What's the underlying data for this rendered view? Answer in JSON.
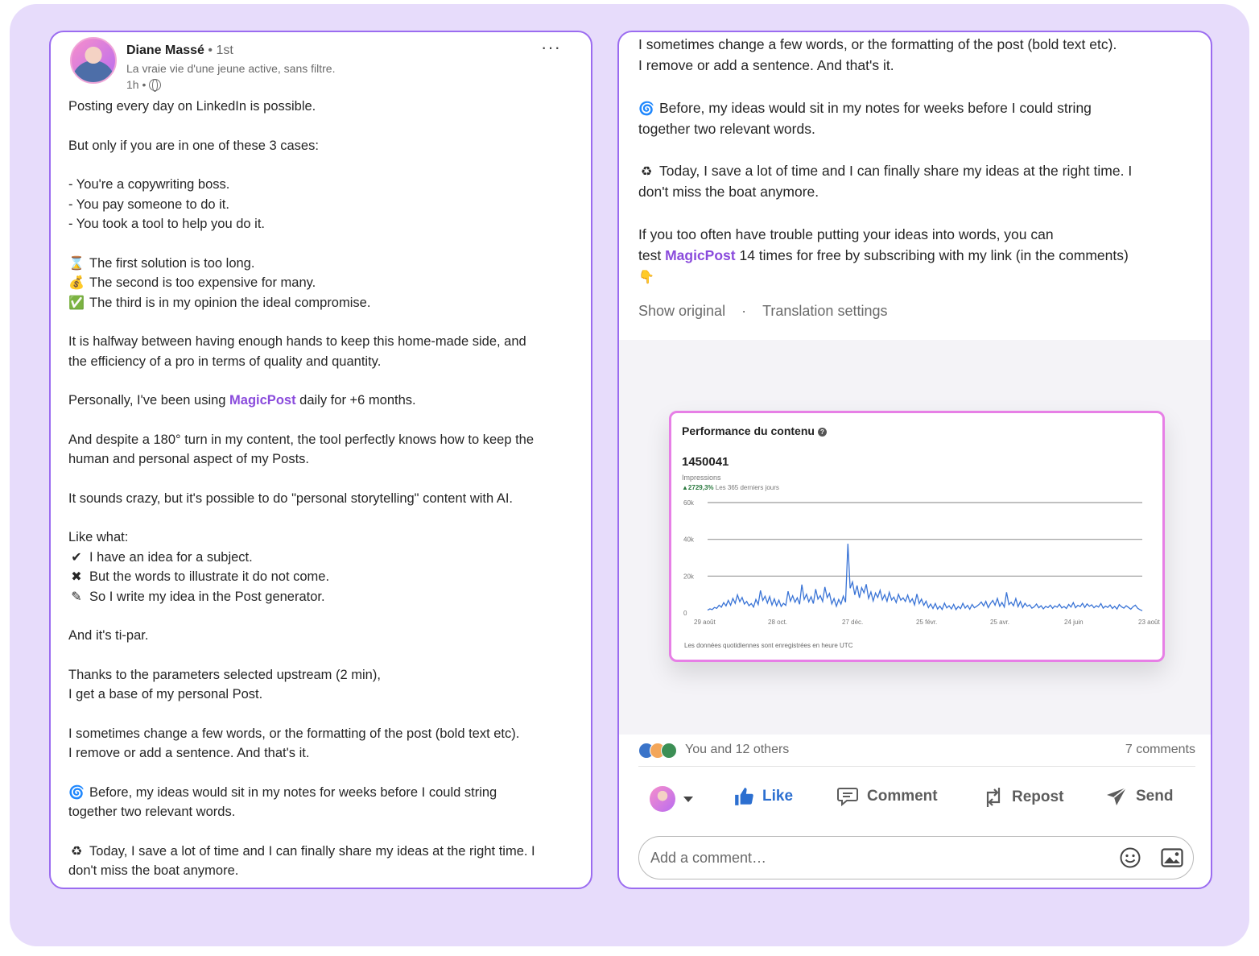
{
  "post": {
    "author_name": "Diane Massé",
    "author_degree": "• 1st",
    "author_tagline": "La vraie vie d'une jeune active, sans filtre.",
    "time": "1h •",
    "more": "···"
  },
  "left_lines": [
    {
      "text": "Posting every day on LinkedIn is possible."
    },
    {
      "blank": true
    },
    {
      "text": "But only if you are in one of these 3 cases:"
    },
    {
      "blank": true
    },
    {
      "text": "- You're a copywriting boss."
    },
    {
      "text": "- You pay someone to do it."
    },
    {
      "text": "- You took a tool to help you do it."
    },
    {
      "blank": true
    },
    {
      "emoji": "⌛",
      "text": "The first solution is too long."
    },
    {
      "emoji": "💰",
      "text": "The second is too expensive for many."
    },
    {
      "emoji": "✅",
      "text": "The third is in my opinion the ideal compromise."
    },
    {
      "blank": true
    },
    {
      "text": "It is halfway between having enough hands to keep this home-made side, and"
    },
    {
      "text": "the efficiency of a pro in terms of quality and quantity."
    },
    {
      "blank": true
    },
    {
      "text": "Personally, I've been using ",
      "link": "MagicPost",
      "after": " daily for +6 months."
    },
    {
      "blank": true
    },
    {
      "text": "And despite a 180° turn in my content, the tool perfectly knows how to keep the"
    },
    {
      "text": "human and personal aspect of my Posts."
    },
    {
      "blank": true
    },
    {
      "text": "It sounds crazy, but it's possible to do \"personal storytelling\" content with AI."
    },
    {
      "blank": true
    },
    {
      "text": "Like what:"
    },
    {
      "emoji": "✔",
      "text": "I have an idea for a subject."
    },
    {
      "emoji": "✖",
      "text": "But the words to illustrate it do not come."
    },
    {
      "emoji": "✎",
      "text": "So I write my idea in the Post generator."
    },
    {
      "blank": true
    },
    {
      "text": "And it's ti-par."
    },
    {
      "blank": true
    },
    {
      "text": "Thanks to the parameters selected upstream (2 min),"
    },
    {
      "text": "I get a base of my personal Post."
    },
    {
      "blank": true
    },
    {
      "text": "I sometimes change a few words, or the formatting of the post (bold text etc)."
    },
    {
      "text": "I remove or add a sentence. And that's it."
    },
    {
      "blank": true
    },
    {
      "emoji": "🌀",
      "text": "Before, my ideas would sit in my notes for weeks before I could string"
    },
    {
      "text": "together two relevant words."
    },
    {
      "blank": true
    },
    {
      "emoji": "♻",
      "text": "Today, I save a lot of time and I can finally share my ideas at the right time. I"
    },
    {
      "text": "don't miss the boat anymore."
    }
  ],
  "right_lines": [
    {
      "text": "I sometimes change a few words, or the formatting of the post (bold text etc)."
    },
    {
      "text": "I remove or add a sentence. And that's it."
    },
    {
      "blank": true
    },
    {
      "emoji": "🌀",
      "text": "Before, my ideas would sit in my notes for weeks before I could string"
    },
    {
      "text": "together two relevant words."
    },
    {
      "blank": true
    },
    {
      "emoji": "♻",
      "text": "Today, I save a lot of time and I can finally share my ideas at the right time. I"
    },
    {
      "text": "don't miss the boat anymore."
    },
    {
      "blank": true
    },
    {
      "text": "If you too often have trouble putting your ideas into words, you can"
    },
    {
      "text": "test ",
      "link": "MagicPost",
      "after": " 14 times for free by subscribing with my link (in the comments)"
    },
    {
      "emoji": "👇",
      "text": ""
    }
  ],
  "translation": {
    "show_original": "Show original",
    "separator": "·",
    "settings": "Translation settings"
  },
  "chart_card": {
    "title": "Performance du contenu",
    "help_icon": "?",
    "value": "1450041",
    "value_label": "Impressions",
    "change_arrow": "▲",
    "change_value": "2729,3%",
    "change_label": "Les 365 derniers jours",
    "footnote": "Les données quotidiennes sont enregistrées en heure UTC"
  },
  "chart_data": {
    "type": "line",
    "title": "Performance du contenu",
    "ylabel": "",
    "xlabel": "",
    "ylim": [
      0,
      60000
    ],
    "y_ticks": [
      "0",
      "20k",
      "40k",
      "60k"
    ],
    "y_tick_values": [
      0,
      20000,
      40000,
      60000
    ],
    "x_ticks": [
      "29 août",
      "28 oct.",
      "27 déc.",
      "25 févr.",
      "25 avr.",
      "24 juin",
      "23 août"
    ],
    "grid": true,
    "color": "#3a74d6",
    "series": [
      {
        "values": [
          1500,
          2200,
          1800,
          3000,
          2500,
          4200,
          3100,
          5600,
          3800,
          6800,
          4200,
          7900,
          5200,
          9800,
          6100,
          8400,
          4800,
          6200,
          3900,
          5100,
          3200,
          7300,
          4600,
          12200,
          6800,
          9100,
          5400,
          8900,
          4300,
          7600,
          3900,
          6900,
          3500,
          5200,
          4100,
          11800,
          6400,
          9300,
          5800,
          8200,
          4700,
          15400,
          7300,
          10100,
          6000,
          8800,
          5100,
          12900,
          7500,
          9400,
          6200,
          14100,
          8300,
          10600,
          4900,
          7800,
          3600,
          7300,
          4800,
          9100,
          5800,
          37600,
          13400,
          16800,
          9800,
          14900,
          8200,
          13700,
          10900,
          15600,
          7900,
          11400,
          6500,
          10800,
          8400,
          12300,
          7100,
          9900,
          6300,
          11200,
          7000,
          8600,
          5600,
          10100,
          6900,
          8200,
          6200,
          9700,
          5800,
          7700,
          4400,
          10300,
          5100,
          7500,
          4100,
          6400,
          2900,
          4800,
          2400,
          5100,
          2100,
          3700,
          1900,
          5300,
          2700,
          3900,
          2200,
          4600,
          1800,
          3500,
          2300,
          5200,
          2600,
          4100,
          2000,
          4600,
          2800,
          3600,
          4500,
          5900,
          3800,
          6300,
          2900,
          5100,
          6800,
          4200,
          7900,
          3600,
          5700,
          3200,
          11200,
          4500,
          5800,
          3900,
          7800,
          3400,
          6200,
          2900,
          5200,
          3600,
          4400,
          2600,
          3300,
          4800,
          2800,
          3900,
          2200,
          3600,
          2900,
          4200,
          2500,
          3800,
          3100,
          4700,
          2700,
          3500,
          2400,
          4600,
          3200,
          5600,
          2800,
          4100,
          3400,
          5200,
          3000,
          4900,
          3600,
          4400,
          2800,
          3900,
          3200,
          5100,
          2600,
          3700,
          3000,
          4300,
          2400,
          3600,
          2100,
          4500,
          3300,
          2600,
          3900,
          3000,
          2000,
          3400,
          4200,
          2500,
          1800,
          1200
        ]
      }
    ]
  },
  "social": {
    "reactions_text": "You and 12 others",
    "comments": "7 comments"
  },
  "actions": {
    "like": "Like",
    "comment": "Comment",
    "repost": "Repost",
    "send": "Send"
  },
  "comment_box": {
    "placeholder": "Add a comment…"
  },
  "icons": [
    "globe-icon",
    "more-icon",
    "help-icon",
    "like-icon",
    "comment-icon",
    "repost-icon",
    "send-icon",
    "emoji-icon",
    "image-icon",
    "caret-icon"
  ]
}
